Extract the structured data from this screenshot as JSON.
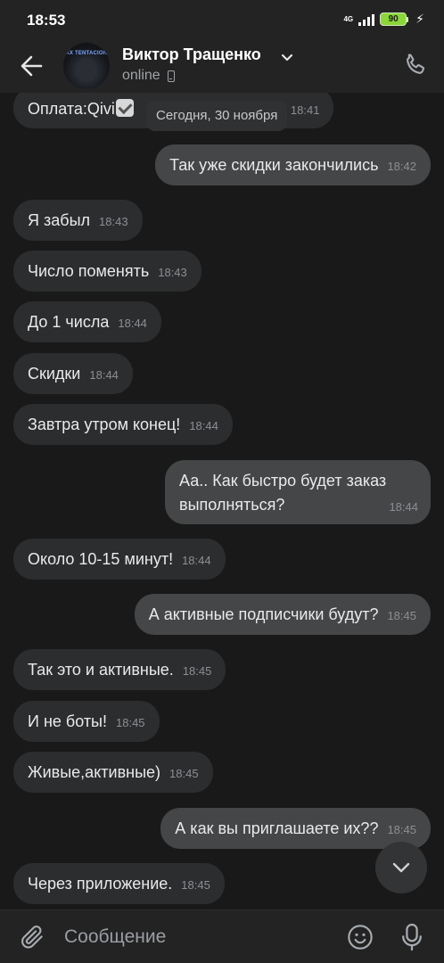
{
  "status_bar": {
    "time": "18:53",
    "network": "4G",
    "battery": "90"
  },
  "header": {
    "contact_name": "Виктор Тращенко",
    "status": "online",
    "avatar_text": "XX TENTACION"
  },
  "date_chip": "Сегодня, 30 ноября",
  "messages": [
    {
      "dir": "in",
      "text": "Оплата:Qivi",
      "time": "18:41",
      "has_check": true
    },
    {
      "dir": "out",
      "text": "Так уже скидки закончились",
      "time": "18:42"
    },
    {
      "dir": "in",
      "text": "Я забыл",
      "time": "18:43"
    },
    {
      "dir": "in",
      "text": "Число поменять",
      "time": "18:43"
    },
    {
      "dir": "in",
      "text": "До 1 числа",
      "time": "18:44"
    },
    {
      "dir": "in",
      "text": "Скидки",
      "time": "18:44"
    },
    {
      "dir": "in",
      "text": "Завтра утром конец!",
      "time": "18:44"
    },
    {
      "dir": "out",
      "text_line1": "Аа.. Как быстро будет заказ",
      "text_line2": "выполняться?",
      "time": "18:44"
    },
    {
      "dir": "in",
      "text": "Около 10-15 минут!",
      "time": "18:44"
    },
    {
      "dir": "out",
      "text": "А активные подписчики будут?",
      "time": "18:45"
    },
    {
      "dir": "in",
      "text": "Так это и активные.",
      "time": "18:45"
    },
    {
      "dir": "in",
      "text": "И не боты!",
      "time": "18:45"
    },
    {
      "dir": "in",
      "text": "Живые,активные)",
      "time": "18:45"
    },
    {
      "dir": "out",
      "text": "А как вы приглашаете их??",
      "time": "18:45"
    },
    {
      "dir": "in",
      "text": "Через приложение.",
      "time": "18:45"
    }
  ],
  "composer": {
    "placeholder": "Сообщение"
  },
  "icons": {
    "back": "arrow-left-icon",
    "call": "phone-icon",
    "expand": "chevron-down-icon",
    "attach": "paperclip-icon",
    "emoji": "smile-icon",
    "mic": "microphone-icon",
    "scroll_down": "chevron-down-icon"
  },
  "colors": {
    "background": "#191919",
    "bar": "#232323",
    "incoming": "#2c2d2e",
    "outgoing": "#454647",
    "battery": "#8bd63a"
  }
}
